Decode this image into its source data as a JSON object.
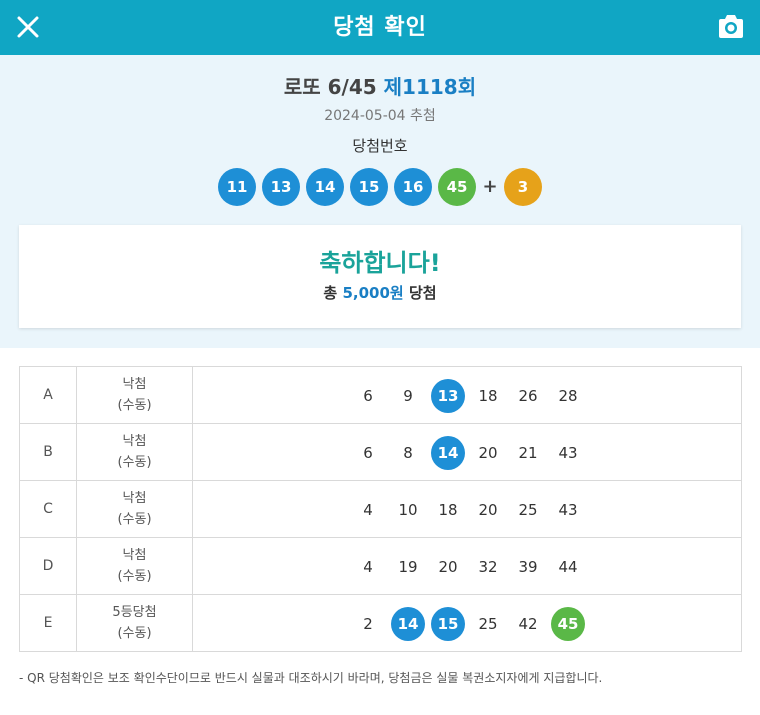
{
  "header": {
    "title": "당첨 확인",
    "close_icon": "close-icon",
    "camera_icon": "camera-icon"
  },
  "draw": {
    "game_name": "로또 6/45",
    "round": "제1118회",
    "date": "2024-05-04 추첨",
    "winning_label": "당첨번호",
    "numbers": [
      {
        "value": "11",
        "color": "#1e8fd6"
      },
      {
        "value": "13",
        "color": "#1e8fd6"
      },
      {
        "value": "14",
        "color": "#1e8fd6"
      },
      {
        "value": "15",
        "color": "#1e8fd6"
      },
      {
        "value": "16",
        "color": "#1e8fd6"
      },
      {
        "value": "45",
        "color": "#5ab847"
      }
    ],
    "plus": "+",
    "bonus": {
      "value": "3",
      "color": "#e6a21a"
    }
  },
  "result": {
    "congrats": "축하합니다!",
    "prize_prefix": "총",
    "prize_amount": "5,000원",
    "prize_suffix": "당첨"
  },
  "colors": {
    "header": "#10a6c4",
    "blue_ball": "#1e8fd6",
    "green_ball": "#5ab847",
    "bonus_ball": "#e6a21a"
  },
  "games": [
    {
      "label": "A",
      "status": "낙첨",
      "mode": "(수동)",
      "numbers": [
        {
          "v": "6"
        },
        {
          "v": "9"
        },
        {
          "v": "13",
          "hit": "#1e8fd6"
        },
        {
          "v": "18"
        },
        {
          "v": "26"
        },
        {
          "v": "28"
        }
      ]
    },
    {
      "label": "B",
      "status": "낙첨",
      "mode": "(수동)",
      "numbers": [
        {
          "v": "6"
        },
        {
          "v": "8"
        },
        {
          "v": "14",
          "hit": "#1e8fd6"
        },
        {
          "v": "20"
        },
        {
          "v": "21"
        },
        {
          "v": "43"
        }
      ]
    },
    {
      "label": "C",
      "status": "낙첨",
      "mode": "(수동)",
      "numbers": [
        {
          "v": "4"
        },
        {
          "v": "10"
        },
        {
          "v": "18"
        },
        {
          "v": "20"
        },
        {
          "v": "25"
        },
        {
          "v": "43"
        }
      ]
    },
    {
      "label": "D",
      "status": "낙첨",
      "mode": "(수동)",
      "numbers": [
        {
          "v": "4"
        },
        {
          "v": "19"
        },
        {
          "v": "20"
        },
        {
          "v": "32"
        },
        {
          "v": "39"
        },
        {
          "v": "44"
        }
      ]
    },
    {
      "label": "E",
      "status": "5등당첨",
      "mode": "(수동)",
      "numbers": [
        {
          "v": "2"
        },
        {
          "v": "14",
          "hit": "#1e8fd6"
        },
        {
          "v": "15",
          "hit": "#1e8fd6"
        },
        {
          "v": "25"
        },
        {
          "v": "42"
        },
        {
          "v": "45",
          "hit": "#5ab847"
        }
      ]
    }
  ],
  "notice": "- QR 당첨확인은 보조 확인수단이므로 반드시 실물과 대조하시기 바라며, 당첨금은 실물 복권소지자에게 지급합니다."
}
